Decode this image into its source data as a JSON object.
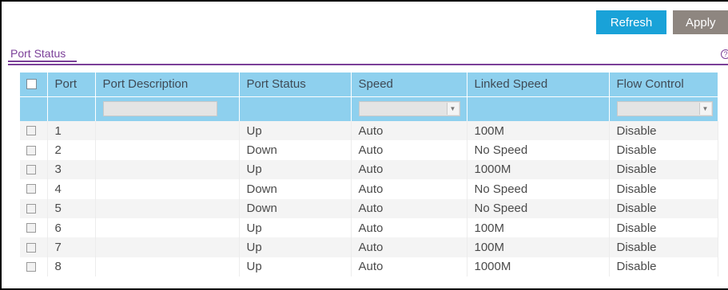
{
  "toolbar": {
    "refresh_label": "Refresh",
    "apply_label": "Apply"
  },
  "tab": {
    "label": "Port Status",
    "help_glyph": "?"
  },
  "table": {
    "headers": {
      "port": "Port",
      "description": "Port Description",
      "status": "Port Status",
      "speed": "Speed",
      "linked_speed": "Linked Speed",
      "flow_control": "Flow Control"
    },
    "filters": {
      "description": "",
      "speed": "",
      "flow_control": ""
    },
    "rows": [
      {
        "port": "1",
        "description": "",
        "status": "Up",
        "speed": "Auto",
        "linked_speed": "100M",
        "flow_control": "Disable"
      },
      {
        "port": "2",
        "description": "",
        "status": "Down",
        "speed": "Auto",
        "linked_speed": "No Speed",
        "flow_control": "Disable"
      },
      {
        "port": "3",
        "description": "",
        "status": "Up",
        "speed": "Auto",
        "linked_speed": "1000M",
        "flow_control": "Disable"
      },
      {
        "port": "4",
        "description": "",
        "status": "Down",
        "speed": "Auto",
        "linked_speed": "No Speed",
        "flow_control": "Disable"
      },
      {
        "port": "5",
        "description": "",
        "status": "Down",
        "speed": "Auto",
        "linked_speed": "No Speed",
        "flow_control": "Disable"
      },
      {
        "port": "6",
        "description": "",
        "status": "Up",
        "speed": "Auto",
        "linked_speed": "100M",
        "flow_control": "Disable"
      },
      {
        "port": "7",
        "description": "",
        "status": "Up",
        "speed": "Auto",
        "linked_speed": "100M",
        "flow_control": "Disable"
      },
      {
        "port": "8",
        "description": "",
        "status": "Up",
        "speed": "Auto",
        "linked_speed": "1000M",
        "flow_control": "Disable"
      }
    ]
  },
  "colors": {
    "accent": "#7b3f98",
    "header_bg": "#8ed0ee",
    "refresh_bg": "#19a2d8",
    "apply_bg": "#8e8680"
  },
  "icons": {
    "help": "help-icon",
    "dropdown": "chevron-down-icon",
    "checkbox": "checkbox-icon"
  }
}
